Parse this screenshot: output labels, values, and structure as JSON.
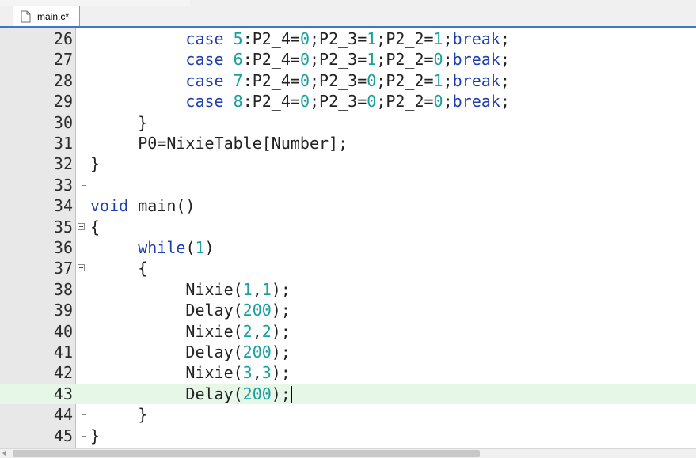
{
  "tab": {
    "label": "main.c*"
  },
  "colors": {
    "keyword": "#1f3fb0",
    "number": "#1aa0a0",
    "current_line": "#e6f7e8",
    "gutter": "#e8e8e8"
  },
  "lines": [
    {
      "n": "26",
      "parts": [
        [
          "t",
          "          "
        ],
        [
          "k",
          "case"
        ],
        [
          "t",
          " "
        ],
        [
          "n",
          "5"
        ],
        [
          "t",
          ":P2_4="
        ],
        [
          "n",
          "0"
        ],
        [
          "t",
          ";P2_3="
        ],
        [
          "n",
          "1"
        ],
        [
          "t",
          ";P2_2="
        ],
        [
          "n",
          "1"
        ],
        [
          "t",
          ";"
        ],
        [
          "k",
          "break"
        ],
        [
          "t",
          ";"
        ]
      ]
    },
    {
      "n": "27",
      "parts": [
        [
          "t",
          "          "
        ],
        [
          "k",
          "case"
        ],
        [
          "t",
          " "
        ],
        [
          "n",
          "6"
        ],
        [
          "t",
          ":P2_4="
        ],
        [
          "n",
          "0"
        ],
        [
          "t",
          ";P2_3="
        ],
        [
          "n",
          "1"
        ],
        [
          "t",
          ";P2_2="
        ],
        [
          "n",
          "0"
        ],
        [
          "t",
          ";"
        ],
        [
          "k",
          "break"
        ],
        [
          "t",
          ";"
        ]
      ]
    },
    {
      "n": "28",
      "parts": [
        [
          "t",
          "          "
        ],
        [
          "k",
          "case"
        ],
        [
          "t",
          " "
        ],
        [
          "n",
          "7"
        ],
        [
          "t",
          ":P2_4="
        ],
        [
          "n",
          "0"
        ],
        [
          "t",
          ";P2_3="
        ],
        [
          "n",
          "0"
        ],
        [
          "t",
          ";P2_2="
        ],
        [
          "n",
          "1"
        ],
        [
          "t",
          ";"
        ],
        [
          "k",
          "break"
        ],
        [
          "t",
          ";"
        ]
      ]
    },
    {
      "n": "29",
      "parts": [
        [
          "t",
          "          "
        ],
        [
          "k",
          "case"
        ],
        [
          "t",
          " "
        ],
        [
          "n",
          "8"
        ],
        [
          "t",
          ":P2_4="
        ],
        [
          "n",
          "0"
        ],
        [
          "t",
          ";P2_3="
        ],
        [
          "n",
          "0"
        ],
        [
          "t",
          ";P2_2="
        ],
        [
          "n",
          "0"
        ],
        [
          "t",
          ";"
        ],
        [
          "k",
          "break"
        ],
        [
          "t",
          ";"
        ]
      ]
    },
    {
      "n": "30",
      "parts": [
        [
          "t",
          "     }"
        ]
      ]
    },
    {
      "n": "31",
      "parts": [
        [
          "t",
          "     P0=NixieTable[Number];"
        ]
      ]
    },
    {
      "n": "32",
      "parts": [
        [
          "t",
          "}"
        ]
      ]
    },
    {
      "n": "33",
      "parts": [
        [
          "t",
          ""
        ]
      ]
    },
    {
      "n": "34",
      "parts": [
        [
          "k",
          "void"
        ],
        [
          "t",
          " main()"
        ]
      ]
    },
    {
      "n": "35",
      "parts": [
        [
          "t",
          "{"
        ]
      ]
    },
    {
      "n": "36",
      "parts": [
        [
          "t",
          "     "
        ],
        [
          "k",
          "while"
        ],
        [
          "t",
          "("
        ],
        [
          "n",
          "1"
        ],
        [
          "t",
          ")"
        ]
      ]
    },
    {
      "n": "37",
      "parts": [
        [
          "t",
          "     {"
        ]
      ]
    },
    {
      "n": "38",
      "parts": [
        [
          "t",
          "          Nixie("
        ],
        [
          "n",
          "1"
        ],
        [
          "t",
          ","
        ],
        [
          "n",
          "1"
        ],
        [
          "t",
          ");"
        ]
      ]
    },
    {
      "n": "39",
      "parts": [
        [
          "t",
          "          Delay("
        ],
        [
          "n",
          "200"
        ],
        [
          "t",
          ");"
        ]
      ]
    },
    {
      "n": "40",
      "parts": [
        [
          "t",
          "          Nixie("
        ],
        [
          "n",
          "2"
        ],
        [
          "t",
          ","
        ],
        [
          "n",
          "2"
        ],
        [
          "t",
          ");"
        ]
      ]
    },
    {
      "n": "41",
      "parts": [
        [
          "t",
          "          Delay("
        ],
        [
          "n",
          "200"
        ],
        [
          "t",
          ");"
        ]
      ]
    },
    {
      "n": "42",
      "parts": [
        [
          "t",
          "          Nixie("
        ],
        [
          "n",
          "3"
        ],
        [
          "t",
          ","
        ],
        [
          "n",
          "3"
        ],
        [
          "t",
          ");"
        ]
      ]
    },
    {
      "n": "43",
      "parts": [
        [
          "t",
          "          Delay("
        ],
        [
          "n",
          "200"
        ],
        [
          "t",
          ");"
        ]
      ],
      "current": true
    },
    {
      "n": "44",
      "parts": [
        [
          "t",
          "     }"
        ]
      ]
    },
    {
      "n": "45",
      "parts": [
        [
          "t",
          "}"
        ]
      ]
    }
  ]
}
